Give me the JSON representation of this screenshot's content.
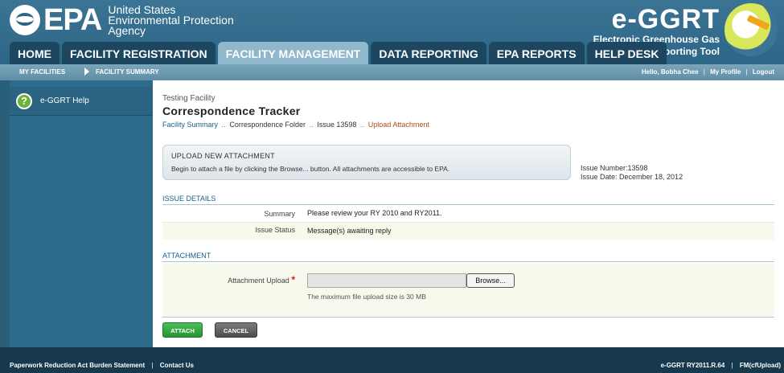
{
  "header": {
    "epa_word": "EPA",
    "agency_line1": "United States",
    "agency_line2": "Environmental Protection",
    "agency_line3": "Agency",
    "eggrt_title": "e-GGRT",
    "eggrt_sub1": "Electronic Greenhouse Gas",
    "eggrt_sub2": "Reporting Tool"
  },
  "tabs": [
    {
      "label": "HOME"
    },
    {
      "label": "FACILITY REGISTRATION"
    },
    {
      "label": "FACILITY MANAGEMENT"
    },
    {
      "label": "DATA REPORTING"
    },
    {
      "label": "EPA REPORTS"
    },
    {
      "label": "HELP DESK"
    }
  ],
  "subnav": {
    "my_facilities": "MY FACILITIES",
    "facility_summary": "FACILITY SUMMARY",
    "hello": "Hello, Bobha Chee",
    "my_profile": "My Profile",
    "logout": "Logout",
    "sep": "|"
  },
  "sidebar": {
    "help_label": "e-GGRT Help"
  },
  "main": {
    "facility_name": "Testing Facility",
    "title": "Correspondence Tracker",
    "breadcrumb": {
      "facility_summary": "Facility Summary",
      "correspondence_folder": "Correspondence Folder",
      "issue": "Issue 13598",
      "current": "Upload Attachment",
      "sep": "․․"
    },
    "upload_box": {
      "title": "UPLOAD NEW ATTACHMENT",
      "text": "Begin to attach a file by clicking the Browse... button. All attachments are accessible to EPA."
    },
    "issue_number": "Issue Number:13598",
    "issue_date": "Issue Date: December 18, 2012",
    "issue_details": {
      "header": "ISSUE DETAILS",
      "summary_label": "Summary",
      "summary_value": "Please review your RY 2010 and RY2011.",
      "status_label": "Issue Status",
      "status_value": "Message(s) awaiting reply"
    },
    "attachment": {
      "header": "ATTACHMENT",
      "upload_label": "Attachment Upload",
      "required_mark": "*",
      "browse_label": "Browse...",
      "hint": "The maximum file upload size is 30 MB"
    },
    "buttons": {
      "attach": "ATTACH",
      "cancel": "CANCEL"
    }
  },
  "footer": {
    "paperwork": "Paperwork Reduction Act Burden Statement",
    "contact": "Contact Us",
    "version": "e-GGRT RY2011.R.64",
    "fm": "FM(cfUpload)",
    "sep": "|"
  }
}
